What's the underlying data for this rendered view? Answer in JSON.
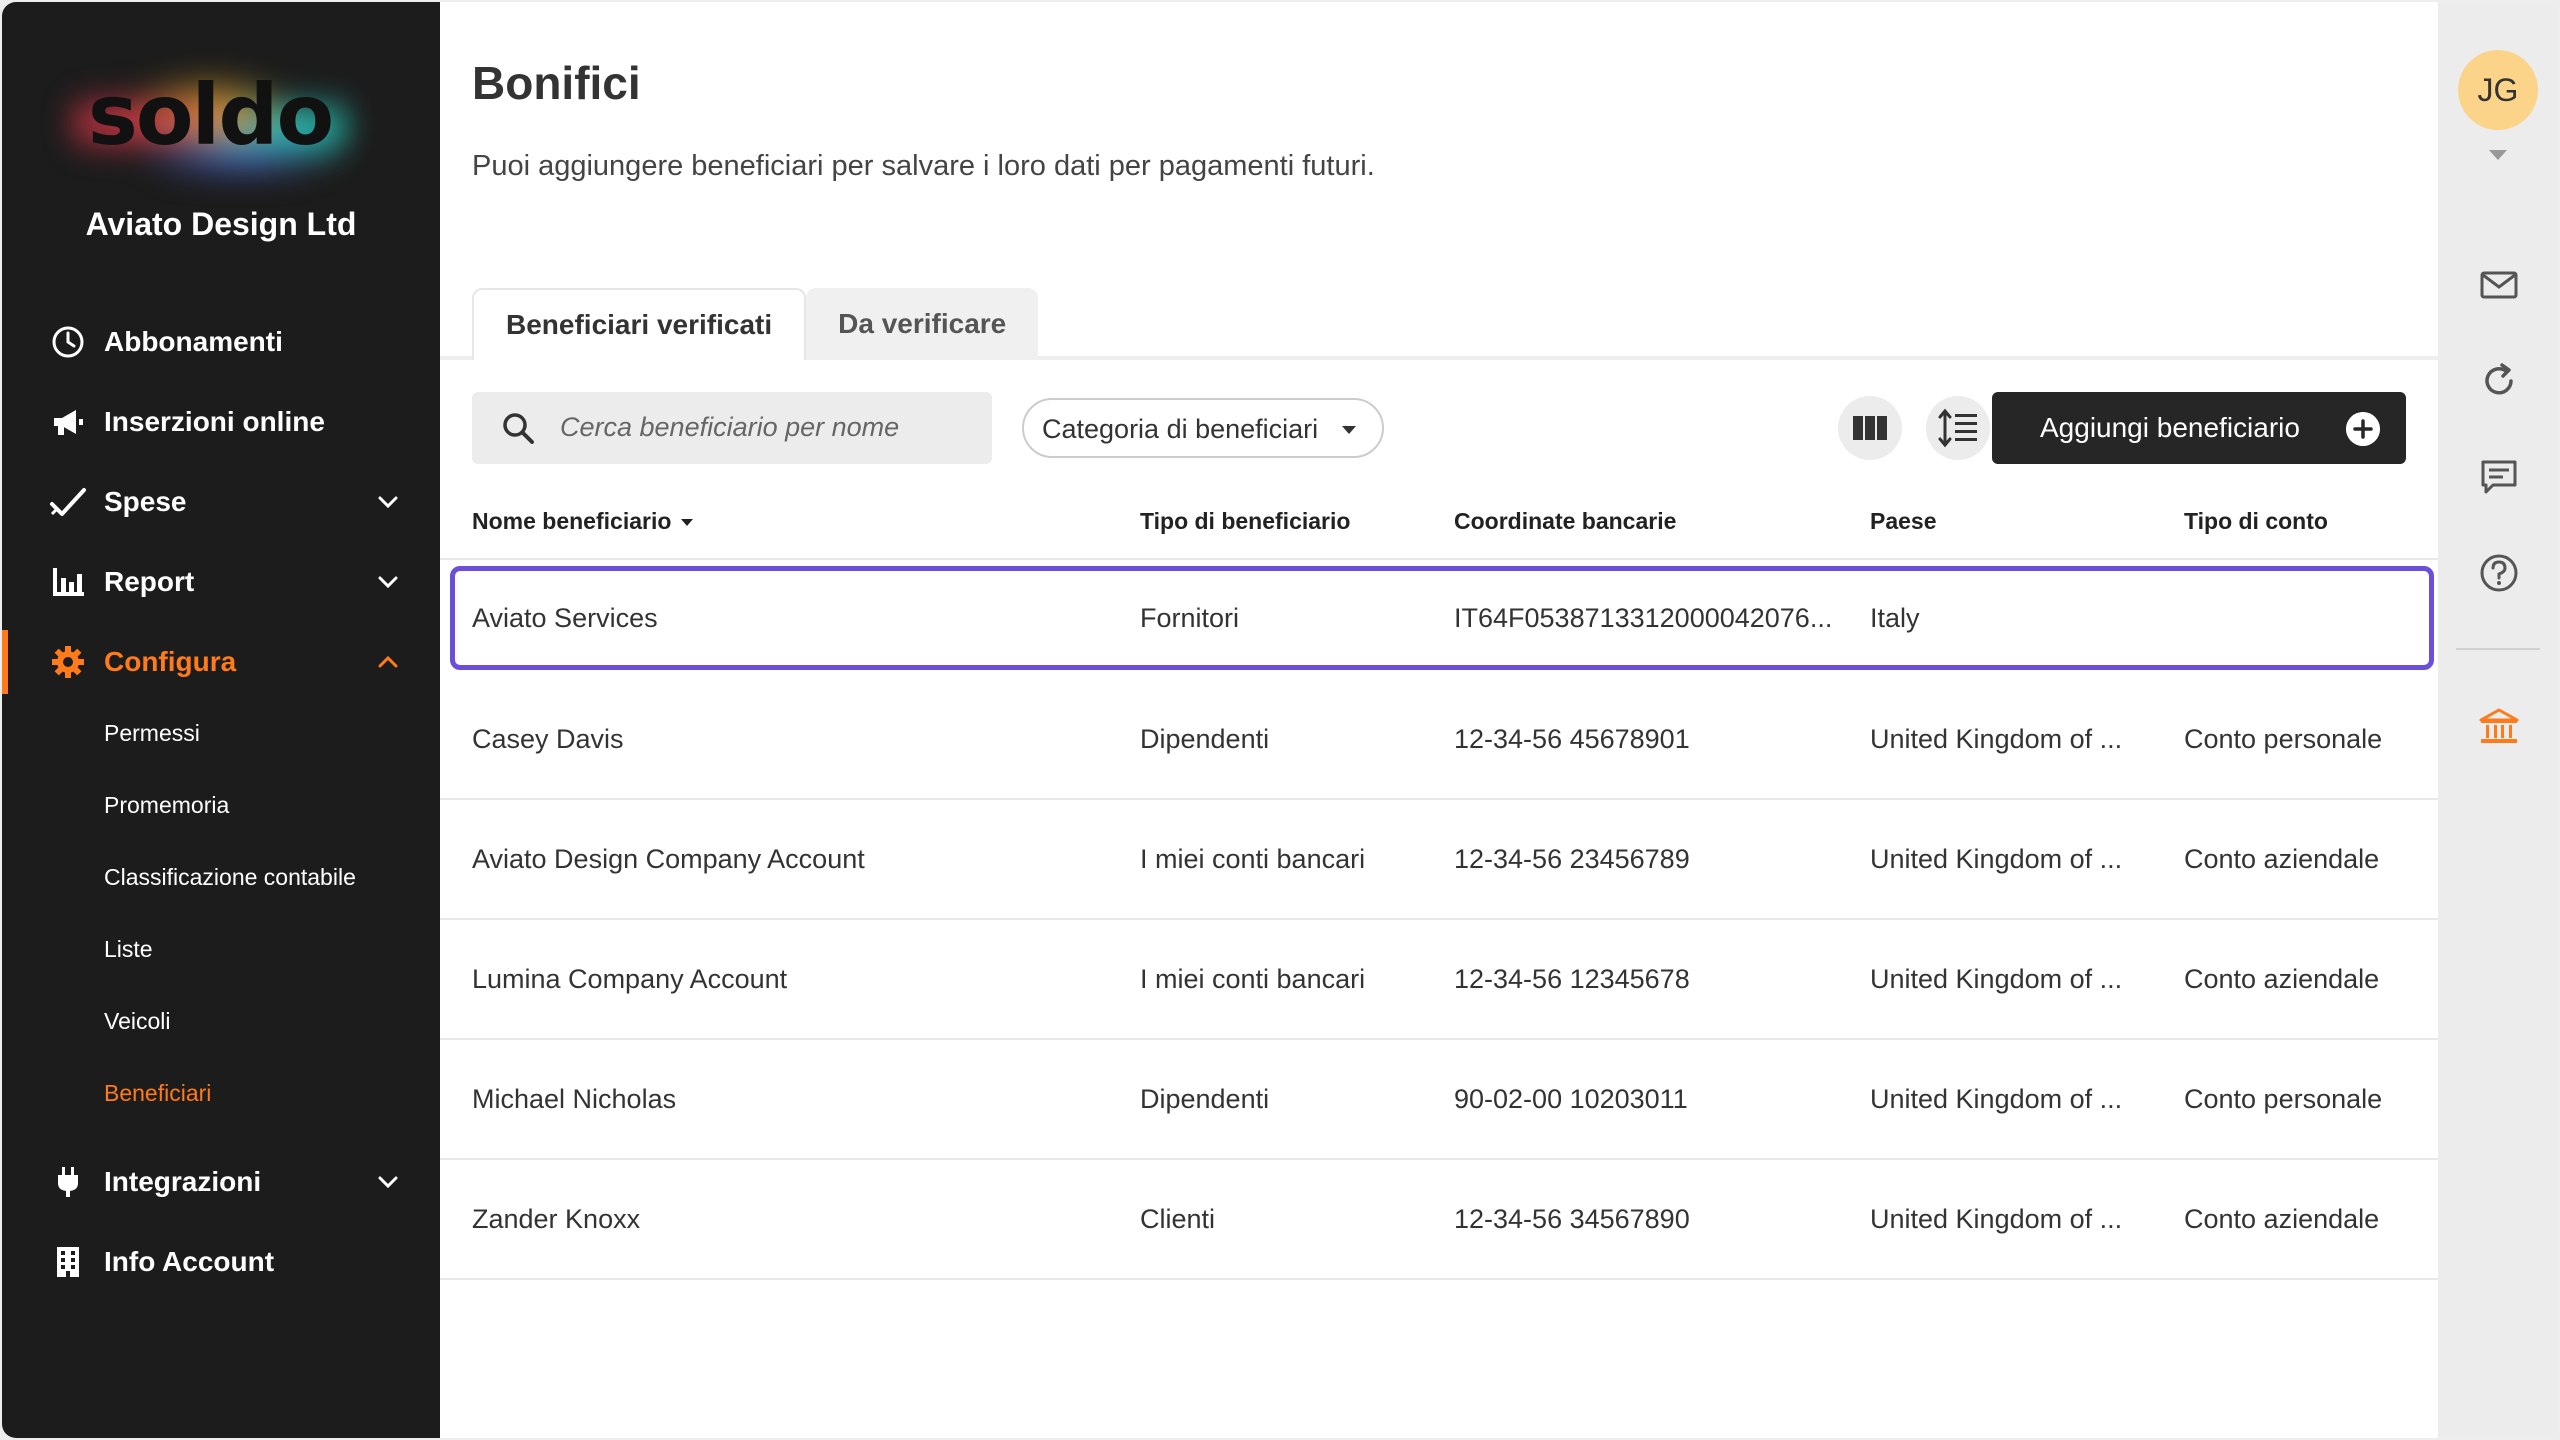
{
  "app": {
    "logo_text": "soldo",
    "company_name": "Aviato Design Ltd"
  },
  "sidebar": {
    "items": [
      {
        "label": "Abbonamenti",
        "icon": "clock-icon"
      },
      {
        "label": "Inserzioni online",
        "icon": "megaphone-icon"
      },
      {
        "label": "Spese",
        "icon": "checkmark-icon",
        "expandable": true,
        "expanded": false
      },
      {
        "label": "Report",
        "icon": "bar-chart-icon",
        "expandable": true,
        "expanded": false
      },
      {
        "label": "Configura",
        "icon": "gear-icon",
        "expandable": true,
        "expanded": true,
        "active": true
      },
      {
        "label": "Integrazioni",
        "icon": "plug-icon",
        "expandable": true,
        "expanded": false
      },
      {
        "label": "Info Account",
        "icon": "building-icon"
      }
    ],
    "configura_subitems": [
      {
        "label": "Permessi"
      },
      {
        "label": "Promemoria"
      },
      {
        "label": "Classificazione contabile"
      },
      {
        "label": "Liste"
      },
      {
        "label": "Veicoli"
      },
      {
        "label": "Beneficiari",
        "active": true
      }
    ]
  },
  "main": {
    "title": "Bonifici",
    "subtitle": "Puoi aggiungere beneficiari per salvare i loro dati per pagamenti futuri.",
    "tabs": [
      {
        "label": "Beneficiari verificati",
        "active": true
      },
      {
        "label": "Da verificare",
        "active": false
      }
    ],
    "search": {
      "placeholder": "Cerca beneficiario per nome",
      "value": ""
    },
    "category_filter": {
      "label": "Categoria di beneficiari"
    },
    "add_button": {
      "label": "Aggiungi beneficiario"
    },
    "table": {
      "columns": [
        "Nome beneficiario",
        "Tipo di beneficiario",
        "Coordinate bancarie",
        "Paese",
        "Tipo di conto"
      ],
      "rows": [
        {
          "name": "Aviato Services",
          "type": "Fornitori",
          "bank": "IT64F0538713312000042076...",
          "country": "Italy",
          "account": "",
          "selected": true
        },
        {
          "name": "Casey Davis",
          "type": "Dipendenti",
          "bank": "12-34-56 45678901",
          "country": "United Kingdom of ...",
          "account": "Conto personale"
        },
        {
          "name": "Aviato Design Company Account",
          "type": "I miei conti bancari",
          "bank": "12-34-56 23456789",
          "country": "United Kingdom of ...",
          "account": "Conto aziendale"
        },
        {
          "name": "Lumina Company Account",
          "type": "I miei conti bancari",
          "bank": "12-34-56 12345678",
          "country": "United Kingdom of ...",
          "account": "Conto aziendale"
        },
        {
          "name": "Michael Nicholas",
          "type": "Dipendenti",
          "bank": "90-02-00 10203011",
          "country": "United Kingdom of ...",
          "account": "Conto personale"
        },
        {
          "name": "Zander Knoxx",
          "type": "Clienti",
          "bank": "12-34-56 34567890",
          "country": "United Kingdom of ...",
          "account": "Conto aziendale"
        }
      ]
    }
  },
  "rail": {
    "avatar_initials": "JG",
    "icons": [
      "mail-icon",
      "refresh-icon",
      "chat-icon",
      "help-icon",
      "bank-icon"
    ]
  },
  "colors": {
    "accent": "#ff7a1a",
    "sidebar_bg": "#1c1c1c",
    "selection": "#6b4fd8",
    "primary_button": "#262626",
    "avatar_bg": "#fbd48a"
  }
}
